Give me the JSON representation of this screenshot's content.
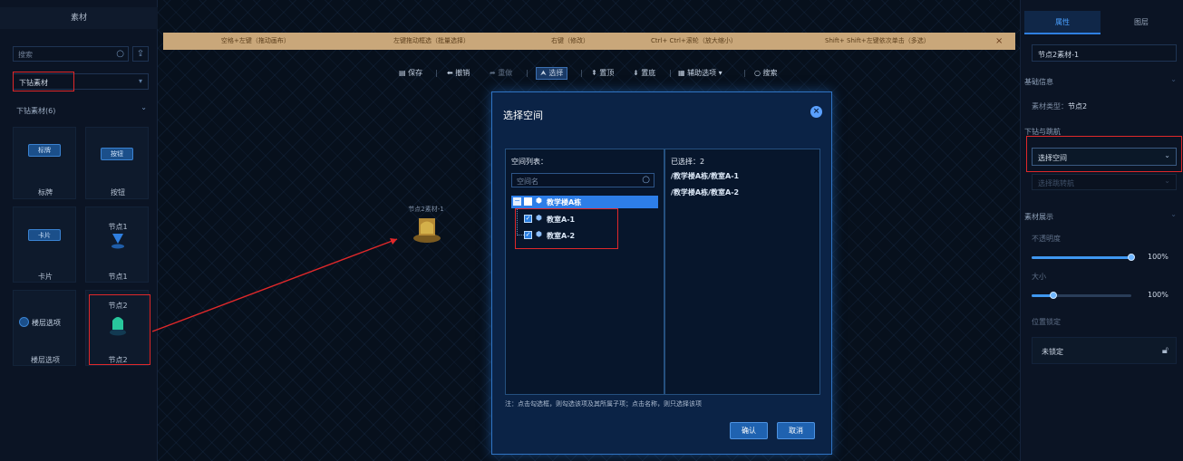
{
  "left_panel": {
    "title": "素材",
    "search_placeholder": "搜索",
    "category_select": "下钻素材",
    "group_label": "下钻素材(6)",
    "items": [
      {
        "chip": "标牌",
        "label": "标牌"
      },
      {
        "chip": "按钮",
        "label": "按钮"
      },
      {
        "chip": "卡片",
        "label": "卡片"
      },
      {
        "top": "节点1",
        "label": "节点1"
      },
      {
        "chip": "楼层选项",
        "label": "楼层选项"
      },
      {
        "top": "节点2",
        "label": "节点2"
      }
    ]
  },
  "hint_bar": {
    "items": [
      "空格+左键（拖动画布）",
      "左键拖动框选（批量选择）",
      "右键（修改）",
      "Ctrl+ Ctrl+滚轮（放大缩小）",
      "Shift+ Shift+左键依次单击（多选）"
    ],
    "close": "×"
  },
  "toolbar": {
    "save": "保存",
    "undo": "撤销",
    "redo": "重做",
    "select": "选择",
    "top": "置顶",
    "bottom": "置底",
    "aux": "辅助选项",
    "search": "搜索",
    "sep": "|"
  },
  "canvas": {
    "node_label": "节点2素材-1"
  },
  "dialog": {
    "title": "选择空间",
    "list_label": "空间列表：",
    "search_placeholder": "空间名",
    "tree": {
      "root": "教学楼A栋",
      "children": [
        {
          "label": "教室A-1",
          "checked": true
        },
        {
          "label": "教室A-2",
          "checked": true
        }
      ]
    },
    "selected_label": "已选择：2",
    "selected": [
      "/教学楼A栋/教室A-1",
      "/教学楼A栋/教室A-2"
    ],
    "note": "注：点击勾选框，则勾选该项及其所属子项；点击名称，则只选择该项",
    "confirm": "确认",
    "cancel": "取消"
  },
  "right_panel": {
    "tabs": [
      "属性",
      "图层"
    ],
    "name_value": "节点2素材-1",
    "basic_info": "基础信息",
    "type_label": "素材类型：",
    "type_value": "节点2",
    "drill_section": "下钻与跳航",
    "select_space": "选择空间",
    "select_jump": "选择跳转航",
    "display_section": "素材展示",
    "opacity_label": "不透明度",
    "opacity_value": "100%",
    "opacity_level": 1.0,
    "size_label": "大小",
    "size_value": "100%",
    "size_level": 0.22,
    "lock_section": "位置锁定",
    "lock_value": "未锁定"
  },
  "colors": {
    "accent": "#2a7ee0",
    "annotation": "#e0282a",
    "hint_bg": "#c9a77a"
  }
}
